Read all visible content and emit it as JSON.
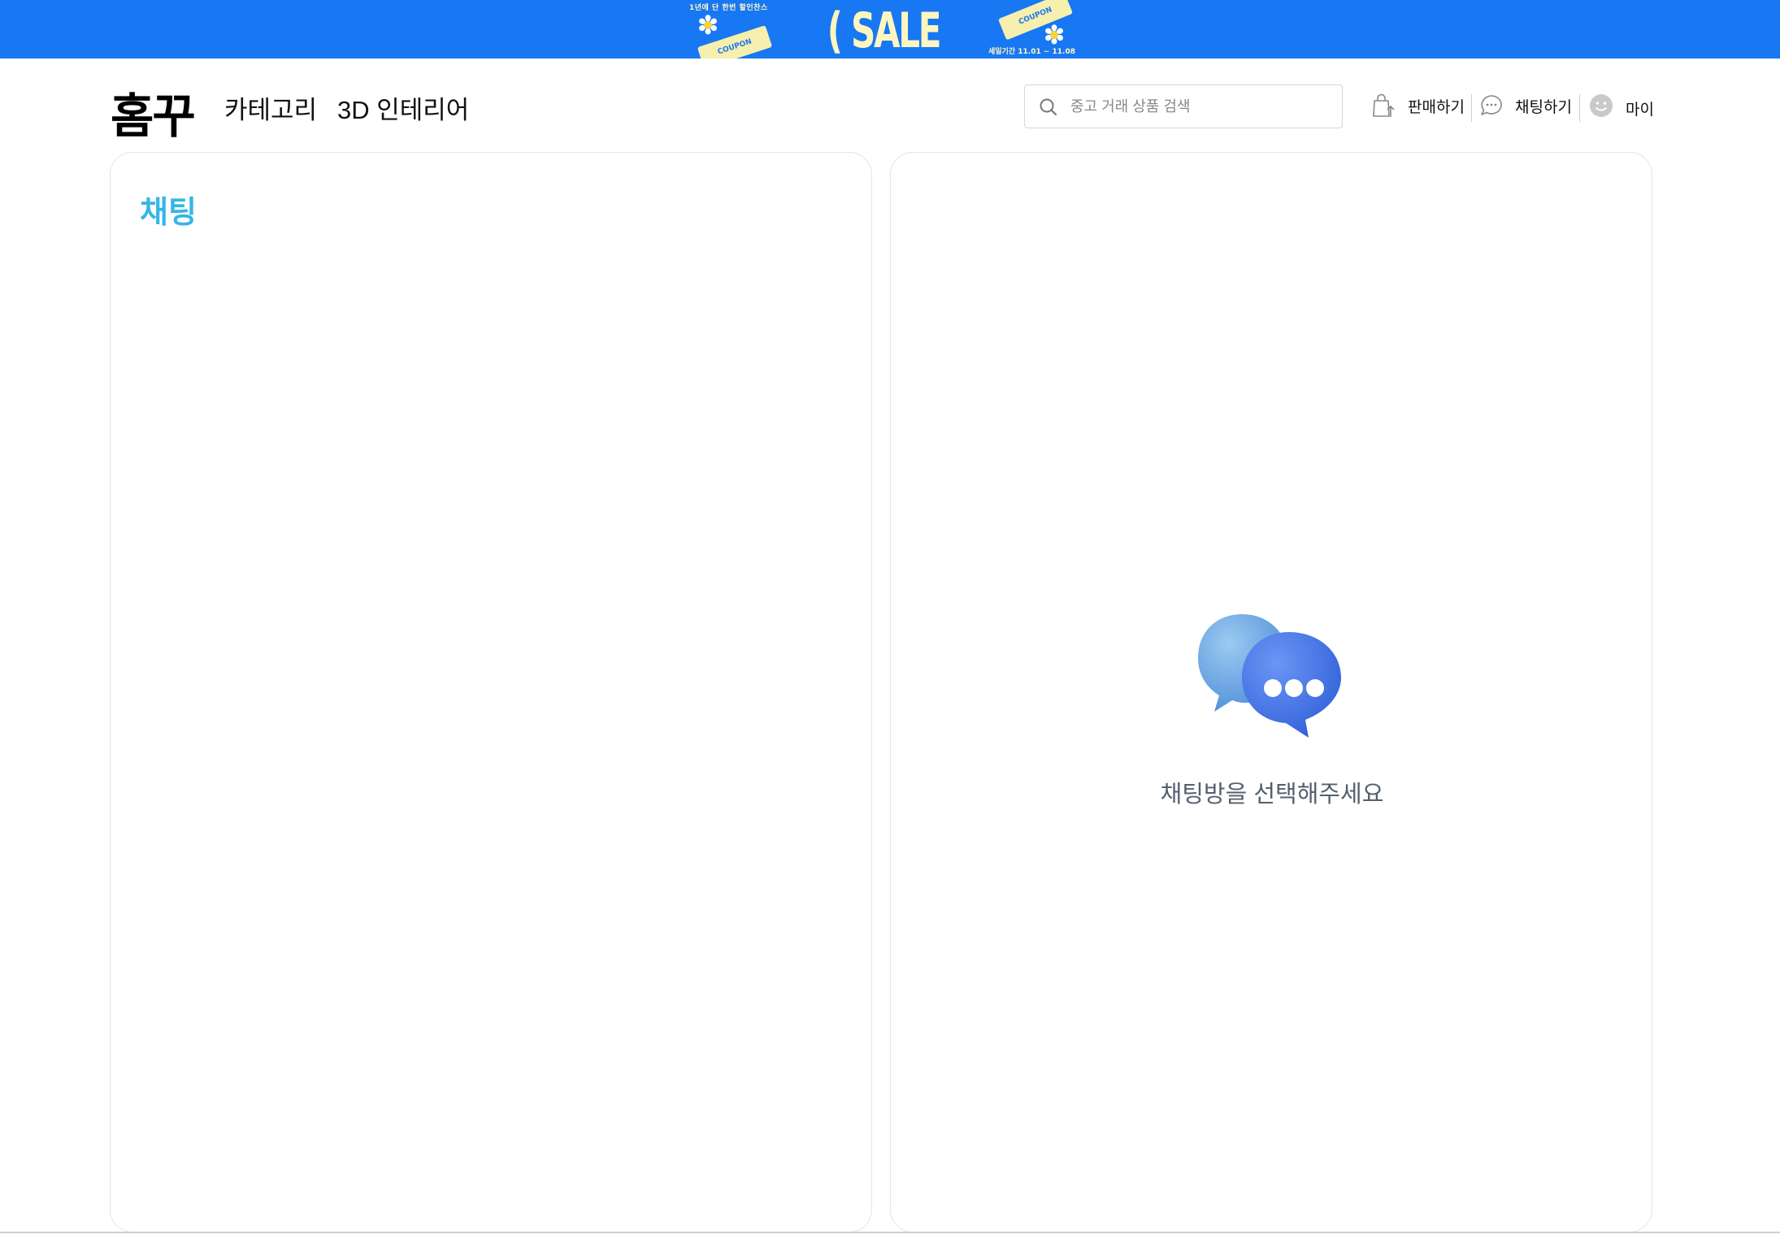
{
  "banner": {
    "tagline": "1년에 단 한번 할인찬스",
    "title": "( SALE WEEK )",
    "coupon_left": "COUPON",
    "coupon_right": "COUPON",
    "period": "세일기간 11.01 ~ 11.08",
    "colors": {
      "background": "#1877f2",
      "text": "#fff6bf"
    }
  },
  "header": {
    "logo": "홈꾸",
    "nav": {
      "category": "카테고리",
      "interior_3d": "3D 인테리어"
    },
    "search": {
      "placeholder": "중고 거래 상품 검색",
      "value": "",
      "icon": "search-icon"
    },
    "utilities": {
      "sell": {
        "label": "판매하기",
        "icon": "shopping-bag-upload-icon"
      },
      "chat": {
        "label": "채팅하기",
        "icon": "chat-bubble-icon"
      },
      "my": {
        "label": "마이",
        "icon": "smiley-avatar-icon"
      }
    }
  },
  "chat_list": {
    "title": "채팅",
    "title_color": "#35b6e6"
  },
  "chat_room": {
    "empty_icon": "chat-bubbles-illustration-icon",
    "empty_message": "채팅방을 선택해주세요"
  }
}
